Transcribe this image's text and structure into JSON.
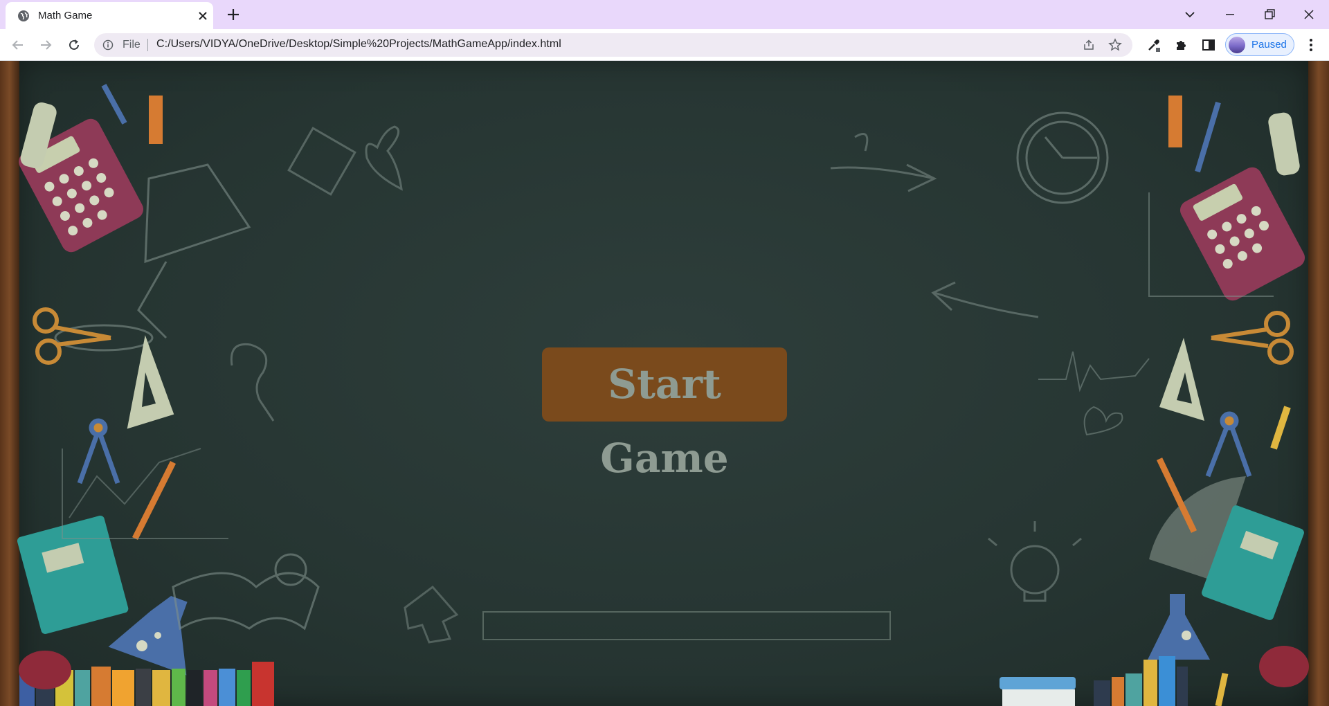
{
  "browser": {
    "tab": {
      "title": "Math Game",
      "favicon": "globe-icon"
    },
    "address": {
      "scheme_label": "File",
      "url": "C:/Users/VIDYA/OneDrive/Desktop/Simple%20Projects/MathGameApp/index.html"
    },
    "profile": {
      "status": "Paused"
    },
    "colors": {
      "tabstrip": "#e9d8fb",
      "omnibox": "#efeaf3",
      "profile_accent": "#1a73e8"
    }
  },
  "game": {
    "start_label": "Start Game",
    "colors": {
      "board": "#263532",
      "button": "#7a4a1c",
      "button_text": "#8e9b92"
    }
  }
}
